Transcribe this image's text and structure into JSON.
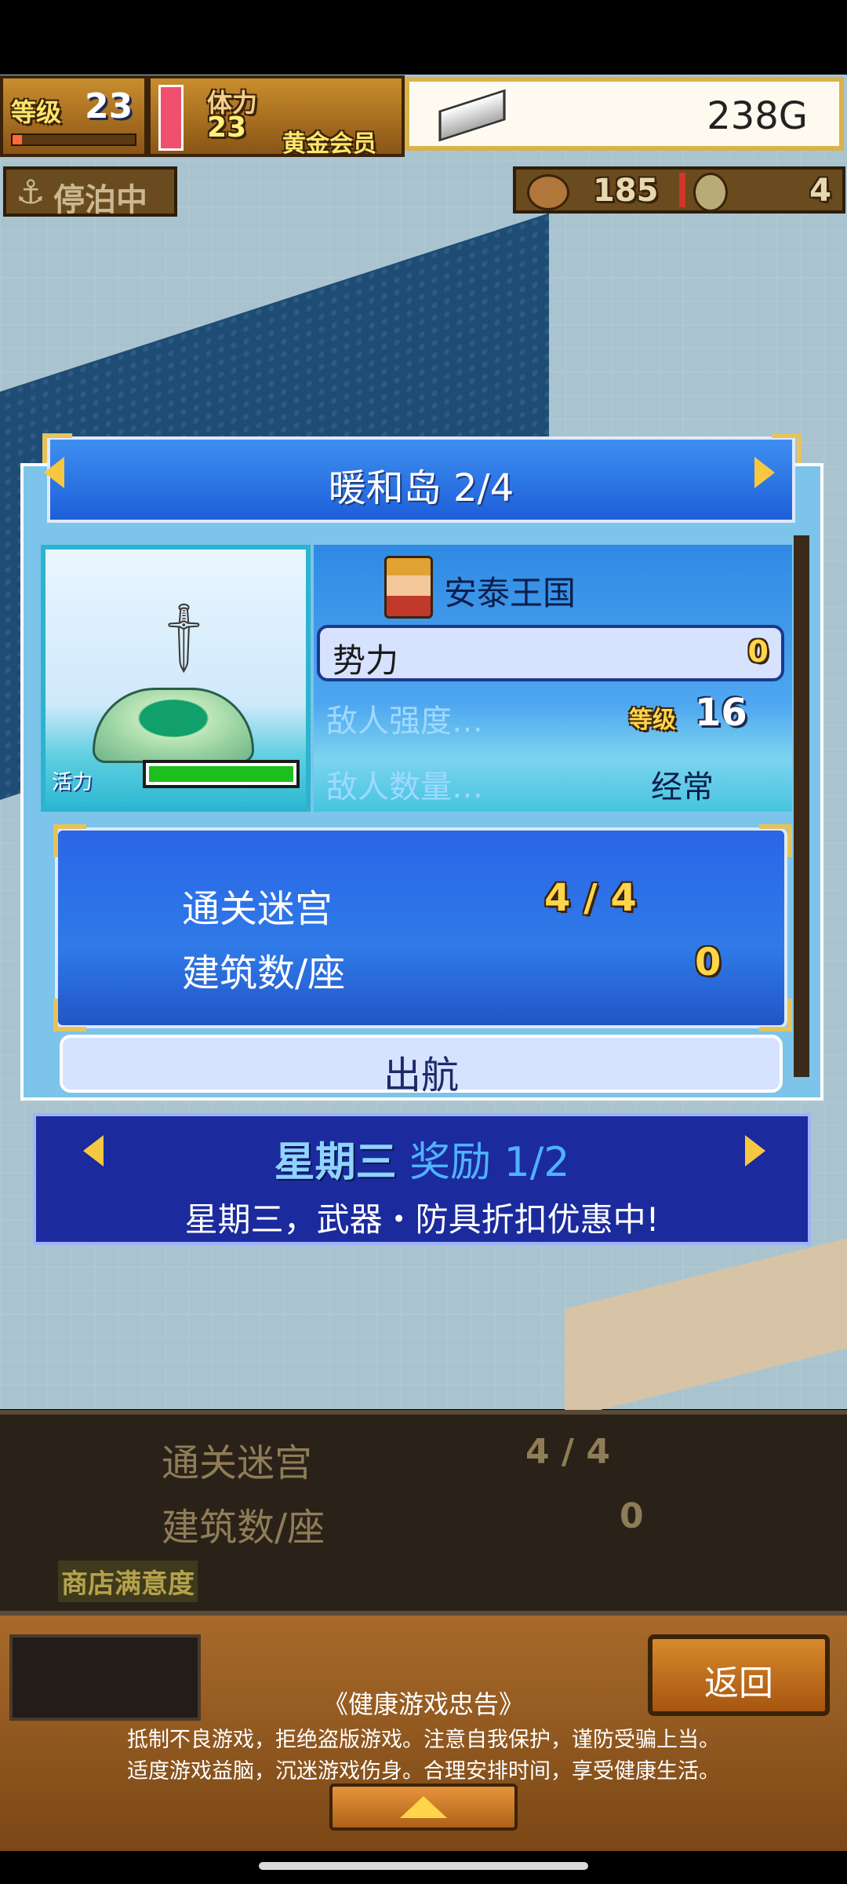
{
  "hud": {
    "level_label": "等级",
    "level_value": "23",
    "stamina_label": "体力",
    "stamina_value": "23",
    "member_label": "黄金会员",
    "gold_amount": "238G",
    "status_label": "停泊中",
    "resource_a": "185",
    "resource_b": "4"
  },
  "island_panel": {
    "title": "暖和岛 2/4",
    "kingdom": "安泰王国",
    "power_label": "势力",
    "power_value": "0",
    "enemy_strength_label": "敌人强度…",
    "enemy_level_label": "等级",
    "enemy_level_value": "16",
    "enemy_count_label": "敌人数量…",
    "enemy_count_value": "经常",
    "vitality_label": "活力",
    "vitality_fraction": 1.0,
    "cleared_label": "通关迷宫",
    "cleared_value": "4 / 4",
    "buildings_label": "建筑数/座",
    "buildings_value": "0",
    "sail_button": "出航"
  },
  "bonus_banner": {
    "day": "星期三",
    "reward": "奖励 1/2",
    "message": "星期三，武器・防具折扣优惠中!"
  },
  "bottom_panel": {
    "cleared_label": "通关迷宫",
    "cleared_value": "4 / 4",
    "buildings_label": "建筑数/座",
    "buildings_value": "0",
    "satisfaction_label": "商店满意度"
  },
  "footer": {
    "back_button": "返回",
    "health_title": "《健康游戏忠告》",
    "health_line1": "抵制不良游戏，拒绝盗版游戏。注意自我保护，谨防受骗上当。",
    "health_line2": "适度游戏益脑，沉迷游戏伤身。合理安排时间，享受健康生活。"
  },
  "colors": {
    "panel_blue": "#2f7ae8",
    "gold": "#f6c842",
    "banner_navy": "#1b2a9c",
    "vitality_green": "#1dbf1d"
  }
}
